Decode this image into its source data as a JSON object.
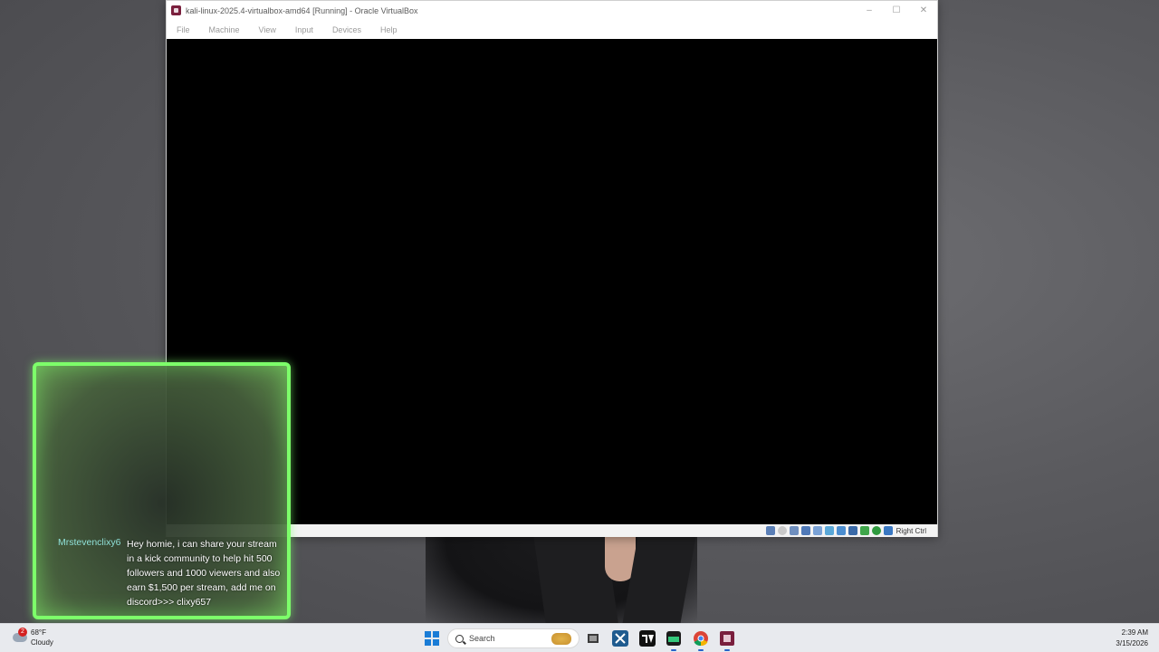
{
  "vbox": {
    "title": "kali-linux-2025.4-virtualbox-amd64 [Running] - Oracle VirtualBox",
    "window_controls": {
      "minimize": "–",
      "maximize": "☐",
      "close": "✕"
    },
    "menu": [
      "File",
      "Machine",
      "View",
      "Input",
      "Devices",
      "Help"
    ],
    "status_icons": [
      "hard-disk-icon",
      "optical-disk-icon",
      "audio-icon",
      "network-icon",
      "usb-icon",
      "shared-folder-icon",
      "display-icon",
      "recording-icon",
      "cpu-icon",
      "mouse-integration-icon",
      "keyboard-icon"
    ],
    "host_key": "Right Ctrl"
  },
  "chat": {
    "username": "Mrstevenclixy6",
    "message": "Hey homie, i can share your stream in a kick community to help hit 500 followers and 1000 viewers and also earn $1,500 per stream, add me on discord>>> clixy657"
  },
  "taskbar": {
    "weather": {
      "badge": "2",
      "temp": "68°F",
      "condition": "Cloudy"
    },
    "search_placeholder": "Search",
    "apps": [
      "file-explorer-icon",
      "snipping-tool-icon",
      "tradingview-icon",
      "terminal-icon",
      "chrome-icon",
      "virtualbox-icon"
    ],
    "clock": {
      "time": "2:39 AM",
      "date": "3/15/2026"
    }
  },
  "colors": {
    "overlay_border": "#7dff6a",
    "chat_username": "#8fe0d7",
    "vm_screen": "#000000"
  }
}
